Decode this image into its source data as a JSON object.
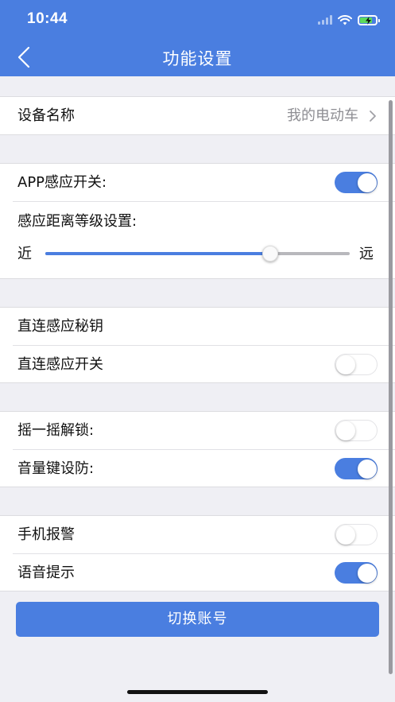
{
  "status_bar": {
    "time": "10:44"
  },
  "nav": {
    "title": "功能设置",
    "back_icon": "chevron-left-icon"
  },
  "device": {
    "label": "设备名称",
    "value": "我的电动车"
  },
  "sensing": {
    "app_switch_label": "APP感应开关:",
    "app_switch_on": true,
    "distance_label": "感应距离等级设置:",
    "near_label": "近",
    "far_label": "远",
    "distance_level_fraction": 0.74
  },
  "direct": {
    "key_label": "直连感应秘钥",
    "switch_label": "直连感应开关",
    "switch_on": false
  },
  "shake": {
    "shake_label": "摇一摇解锁:",
    "shake_on": false,
    "volume_label": "音量键设防:",
    "volume_on": true
  },
  "alerts": {
    "phone_alarm_label": "手机报警",
    "phone_alarm_on": false,
    "voice_label": "语音提示",
    "voice_on": true
  },
  "switch_account_label": "切换账号",
  "colors": {
    "accent": "#4a7ee0",
    "background": "#efeff4"
  }
}
